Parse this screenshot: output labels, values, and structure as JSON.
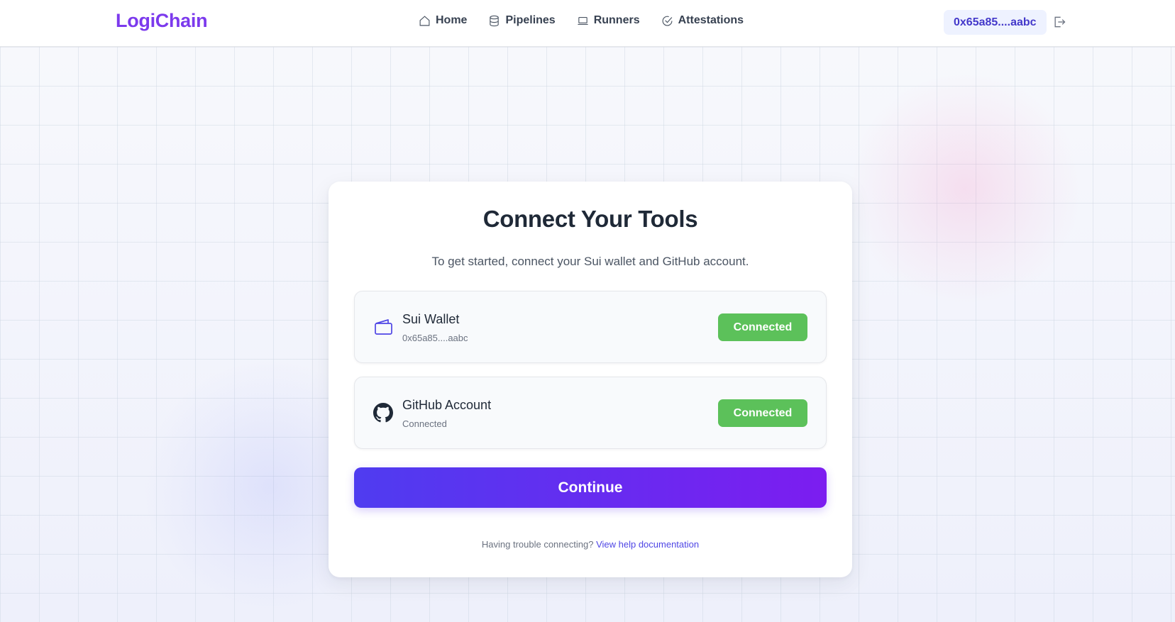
{
  "header": {
    "logo": "LogiChain",
    "nav": [
      {
        "label": "Home",
        "icon": "home-icon"
      },
      {
        "label": "Pipelines",
        "icon": "database-icon"
      },
      {
        "label": "Runners",
        "icon": "laptop-icon"
      },
      {
        "label": "Attestations",
        "icon": "check-circle-icon"
      }
    ],
    "wallet_address": "0x65a85....aabc",
    "logout_icon": "logout-icon"
  },
  "card": {
    "title": "Connect Your Tools",
    "subtitle": "To get started, connect your Sui wallet and GitHub account.",
    "tools": [
      {
        "name": "Sui Wallet",
        "detail": "0x65a85....aabc",
        "status": "Connected",
        "icon": "wallet-icon"
      },
      {
        "name": "GitHub Account",
        "detail": "Connected",
        "status": "Connected",
        "icon": "github-icon"
      }
    ],
    "continue_label": "Continue",
    "help_text": "Having trouble connecting?",
    "help_link": "View help documentation"
  },
  "colors": {
    "brand": "#7c3aed",
    "status_connected": "#5cc15a",
    "continue_gradient_start": "#4f3cf0",
    "continue_gradient_end": "#7c1df0",
    "link": "#4f46e5"
  }
}
